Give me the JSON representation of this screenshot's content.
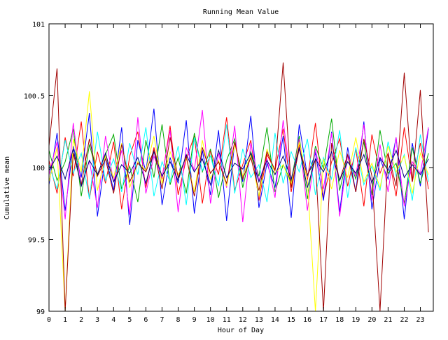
{
  "chart_data": {
    "type": "line",
    "title": "Running Mean Value",
    "xlabel": "Hour of Day",
    "ylabel": "Cumulative mean",
    "xlim": [
      0,
      23.8
    ],
    "ylim": [
      99,
      101
    ],
    "x_ticks": [
      {
        "value": 0,
        "label": "0"
      },
      {
        "value": 1,
        "label": "1"
      },
      {
        "value": 2,
        "label": "2"
      },
      {
        "value": 3,
        "label": "3"
      },
      {
        "value": 4,
        "label": "4"
      },
      {
        "value": 5,
        "label": "5"
      },
      {
        "value": 6,
        "label": "6"
      },
      {
        "value": 7,
        "label": "7"
      },
      {
        "value": 8,
        "label": "8"
      },
      {
        "value": 9,
        "label": "9"
      },
      {
        "value": 10,
        "label": "10"
      },
      {
        "value": 11,
        "label": "11"
      },
      {
        "value": 12,
        "label": "12"
      },
      {
        "value": 13,
        "label": "13"
      },
      {
        "value": 14,
        "label": "14"
      },
      {
        "value": 15,
        "label": "15"
      },
      {
        "value": 16,
        "label": "16"
      },
      {
        "value": 17,
        "label": "17"
      },
      {
        "value": 18,
        "label": "18"
      },
      {
        "value": 19,
        "label": "19"
      },
      {
        "value": 20,
        "label": "20"
      },
      {
        "value": 21,
        "label": "21"
      },
      {
        "value": 22,
        "label": "22"
      },
      {
        "value": 23,
        "label": "23"
      }
    ],
    "y_ticks": [
      {
        "value": 99,
        "label": "99"
      },
      {
        "value": 99.5,
        "label": "99.5"
      },
      {
        "value": 100,
        "label": "100"
      },
      {
        "value": 100.5,
        "label": "100.5"
      },
      {
        "value": 101,
        "label": "101"
      }
    ],
    "grid": false,
    "legend": "none",
    "series_colors": [
      "#ff0000",
      "#0000ff",
      "#00aa00",
      "#ff00ff",
      "#00ffff",
      "#ffff00",
      "#a00000",
      "#000080"
    ],
    "series": [
      {
        "color": "#ff0000",
        "x": [
          0,
          0.5,
          1,
          1.5,
          2,
          2.5,
          3,
          3.5,
          4,
          4.5,
          5,
          5.5,
          6,
          6.5,
          7,
          7.5,
          8,
          8.5,
          9,
          9.5,
          10,
          10.5,
          11,
          11.5,
          12,
          12.5,
          13,
          13.5,
          14,
          14.5,
          15,
          15.5,
          16,
          16.5,
          17,
          17.5,
          18,
          18.5,
          19,
          19.5,
          20,
          20.5,
          21,
          21.5,
          22,
          22.5,
          23,
          23.5
        ],
        "values": [
          100.05,
          99.82,
          100.21,
          99.94,
          100.32,
          99.78,
          100.11,
          99.89,
          100.18,
          99.71,
          100.08,
          100.25,
          99.86,
          100.14,
          99.92,
          100.29,
          99.81,
          100.06,
          100.22,
          99.75,
          100.12,
          99.95,
          100.35,
          99.84,
          100.02,
          100.19,
          99.77,
          100.09,
          99.98,
          100.27,
          99.83,
          100.16,
          99.91,
          100.31,
          99.79,
          100.04,
          100.2,
          99.87,
          100.13,
          99.73,
          100.23,
          99.96,
          100.1,
          99.8,
          100.28,
          99.9,
          100.17,
          99.85
        ]
      },
      {
        "color": "#0000ff",
        "x": [
          0,
          0.5,
          1,
          1.5,
          2,
          2.5,
          3,
          3.5,
          4,
          4.5,
          5,
          5.5,
          6,
          6.5,
          7,
          7.5,
          8,
          8.5,
          9,
          9.5,
          10,
          10.5,
          11,
          11.5,
          12,
          12.5,
          13,
          13.5,
          14,
          14.5,
          15,
          15.5,
          16,
          16.5,
          17,
          17.5,
          18,
          18.5,
          19,
          19.5,
          20,
          20.5,
          21,
          21.5,
          22,
          22.5,
          23,
          23.5
        ],
        "values": [
          99.88,
          100.24,
          99.7,
          100.15,
          99.93,
          100.38,
          99.66,
          100.09,
          99.84,
          100.28,
          99.6,
          100.19,
          99.97,
          100.41,
          99.74,
          100.07,
          99.89,
          100.33,
          99.68,
          100.12,
          99.81,
          100.26,
          99.63,
          100.18,
          99.9,
          100.36,
          99.72,
          100.03,
          99.86,
          100.22,
          99.65,
          100.3,
          99.94,
          100.1,
          99.77,
          100.25,
          99.69,
          100.14,
          99.83,
          100.32,
          99.71,
          100.06,
          99.92,
          100.21,
          99.64,
          100.17,
          99.87,
          100.27
        ]
      },
      {
        "color": "#00aa00",
        "x": [
          0,
          0.5,
          1,
          1.5,
          2,
          2.5,
          3,
          3.5,
          4,
          4.5,
          5,
          5.5,
          6,
          6.5,
          7,
          7.5,
          8,
          8.5,
          9,
          9.5,
          10,
          10.5,
          11,
          11.5,
          12,
          12.5,
          13,
          13.5,
          14,
          14.5,
          15,
          15.5,
          16,
          16.5,
          17,
          17.5,
          18,
          18.5,
          19,
          19.5,
          20,
          20.5,
          21,
          21.5,
          22,
          22.5,
          23,
          23.5
        ],
        "values": [
          100.12,
          99.91,
          100.04,
          100.27,
          99.8,
          100.16,
          99.95,
          100.09,
          100.23,
          99.85,
          100.01,
          99.76,
          100.19,
          99.93,
          100.3,
          99.88,
          100.07,
          99.82,
          100.24,
          99.97,
          100.13,
          99.79,
          100.05,
          100.2,
          99.86,
          100.11,
          99.94,
          100.28,
          99.83,
          100.02,
          99.9,
          100.22,
          99.78,
          100.15,
          99.99,
          100.34,
          99.84,
          100.08,
          99.92,
          100.18,
          99.81,
          100.26,
          99.96,
          100.03,
          99.75,
          100.14,
          99.89,
          100.1
        ]
      },
      {
        "color": "#ff00ff",
        "x": [
          0,
          0.5,
          1,
          1.5,
          2,
          2.5,
          3,
          3.5,
          4,
          4.5,
          5,
          5.5,
          6,
          6.5,
          7,
          7.5,
          8,
          8.5,
          9,
          9.5,
          10,
          10.5,
          11,
          11.5,
          12,
          12.5,
          13,
          13.5,
          14,
          14.5,
          15,
          15.5,
          16,
          16.5,
          17,
          17.5,
          18,
          18.5,
          19,
          19.5,
          20,
          20.5,
          21,
          21.5,
          22,
          22.5,
          23,
          23.5
        ],
        "values": [
          99.95,
          100.18,
          99.64,
          100.31,
          99.87,
          100.05,
          99.72,
          100.22,
          99.9,
          100.12,
          99.67,
          100.35,
          99.82,
          100.08,
          99.93,
          100.26,
          99.69,
          100.14,
          99.98,
          100.4,
          99.75,
          100.1,
          99.86,
          100.29,
          99.62,
          100.17,
          99.91,
          100.06,
          99.79,
          100.33,
          99.88,
          100.2,
          99.7,
          100.13,
          99.85,
          100.24,
          99.66,
          100.09,
          99.94,
          100.3,
          99.77,
          100.16,
          99.83,
          100.21,
          99.73,
          100.04,
          99.96,
          100.28
        ]
      },
      {
        "color": "#00ffff",
        "x": [
          0,
          0.5,
          1,
          1.5,
          2,
          2.5,
          3,
          3.5,
          4,
          4.5,
          5,
          5.5,
          6,
          6.5,
          7,
          7.5,
          8,
          8.5,
          9,
          9.5,
          10,
          10.5,
          11,
          11.5,
          12,
          12.5,
          13,
          13.5,
          14,
          14.5,
          15,
          15.5,
          16,
          16.5,
          17,
          17.5,
          18,
          18.5,
          19,
          19.5,
          20,
          20.5,
          21,
          21.5,
          22,
          22.5,
          23,
          23.5
        ],
        "values": [
          100.02,
          99.85,
          100.19,
          99.96,
          100.1,
          99.78,
          100.25,
          99.91,
          100.06,
          99.83,
          100.17,
          99.95,
          100.28,
          99.8,
          100.04,
          99.9,
          100.15,
          99.74,
          100.21,
          99.98,
          100.08,
          99.87,
          100.3,
          99.82,
          100.13,
          99.93,
          100.02,
          99.76,
          100.24,
          99.89,
          100.11,
          99.97,
          100.2,
          99.81,
          100.07,
          99.92,
          100.26,
          99.79,
          100.14,
          99.88,
          100.01,
          99.84,
          100.18,
          99.94,
          100.09,
          99.77,
          100.23,
          99.9
        ]
      },
      {
        "color": "#ffff00",
        "x": [
          0,
          0.5,
          1,
          1.5,
          2,
          2.5,
          3,
          3.5,
          4,
          4.5,
          5,
          5.5,
          6,
          6.5,
          7,
          7.5,
          8,
          8.5,
          9,
          9.5,
          10,
          10.5,
          11,
          11.5,
          12,
          12.5,
          13,
          13.5,
          14,
          14.5,
          15,
          15.5,
          16,
          16.5,
          17,
          17.5,
          18,
          18.5,
          19,
          19.5,
          20,
          20.5,
          21,
          21.5,
          22,
          22.5,
          23,
          23.5
        ],
        "values": [
          99.9,
          100.14,
          99.0,
          100.2,
          99.97,
          100.53,
          99.84,
          100.08,
          99.93,
          100.17,
          99.86,
          100.04,
          99.98,
          100.22,
          99.89,
          100.11,
          99.95,
          100.07,
          99.83,
          100.19,
          99.92,
          100.05,
          99.87,
          100.16,
          99.94,
          100.09,
          99.8,
          100.13,
          99.96,
          100.02,
          99.88,
          100.18,
          99.91,
          99.0,
          100.06,
          99.85,
          100.12,
          99.93,
          100.21,
          99.9,
          100.03,
          99.86,
          100.15,
          99.97,
          100.08,
          99.82,
          100.1,
          99.95
        ]
      },
      {
        "color": "#a00000",
        "x": [
          0,
          0.5,
          1,
          1.5,
          2,
          2.5,
          3,
          3.5,
          4,
          4.5,
          5,
          5.5,
          6,
          6.5,
          7,
          7.5,
          8,
          8.5,
          9,
          9.5,
          10,
          10.5,
          11,
          11.5,
          12,
          12.5,
          13,
          13.5,
          14,
          14.5,
          15,
          15.5,
          16,
          16.5,
          17,
          17.5,
          18,
          18.5,
          19,
          19.5,
          20,
          20.5,
          21,
          21.5,
          22,
          22.5,
          23,
          23.5
        ],
        "values": [
          100.15,
          100.69,
          99.0,
          100.1,
          99.88,
          100.2,
          99.94,
          100.06,
          99.82,
          100.16,
          99.9,
          100.03,
          99.97,
          100.12,
          99.85,
          100.21,
          99.93,
          100.08,
          99.8,
          100.14,
          99.96,
          100.04,
          99.89,
          100.18,
          99.92,
          100.07,
          99.84,
          100.11,
          99.98,
          100.73,
          99.86,
          100.13,
          99.95,
          100.05,
          99.0,
          100.17,
          99.91,
          100.09,
          99.83,
          100.2,
          99.94,
          99.0,
          100.1,
          99.87,
          100.66,
          99.9,
          100.54,
          99.55
        ]
      },
      {
        "color": "#000080",
        "x": [
          0,
          0.5,
          1,
          1.5,
          2,
          2.5,
          3,
          3.5,
          4,
          4.5,
          5,
          5.5,
          6,
          6.5,
          7,
          7.5,
          8,
          8.5,
          9,
          9.5,
          10,
          10.5,
          11,
          11.5,
          12,
          12.5,
          13,
          13.5,
          14,
          14.5,
          15,
          15.5,
          16,
          16.5,
          17,
          17.5,
          18,
          18.5,
          19,
          19.5,
          20,
          20.5,
          21,
          21.5,
          22,
          22.5,
          23,
          23.5
        ],
        "values": [
          99.98,
          100.08,
          99.92,
          100.13,
          99.87,
          100.05,
          99.95,
          100.1,
          99.9,
          100.02,
          99.96,
          100.07,
          99.89,
          100.11,
          99.94,
          100.04,
          99.91,
          100.09,
          99.97,
          100.06,
          99.88,
          100.12,
          99.93,
          100.03,
          99.99,
          100.1,
          99.9,
          100.05,
          99.95,
          100.08,
          99.92,
          100.14,
          99.86,
          100.06,
          99.97,
          100.11,
          99.91,
          100.04,
          99.96,
          100.09,
          99.89,
          100.07,
          99.98,
          100.12,
          99.93,
          100.02,
          99.95,
          100.06
        ]
      }
    ]
  }
}
